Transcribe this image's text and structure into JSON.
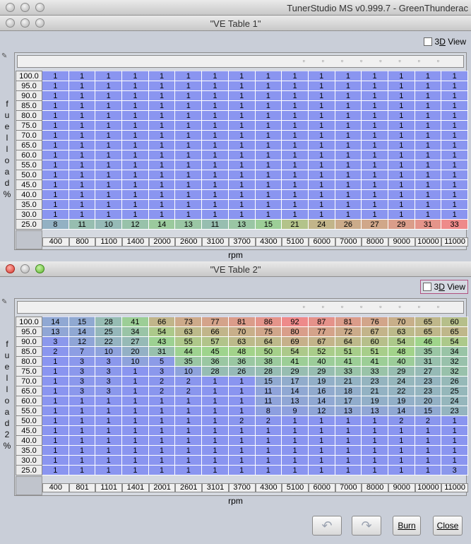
{
  "app_title": "TunerStudio MS v0.999.7 - GreenThunderac",
  "table1": {
    "title": "\"VE Table 1\"",
    "view3d_label_pre": "3",
    "view3d_label_u": "D",
    "view3d_label_post": " View",
    "y_axis_title": [
      "f",
      "u",
      "e",
      "l",
      "l",
      "o",
      "a",
      "d",
      "%"
    ],
    "x_axis_title": "rpm",
    "y_labels": [
      "100.0",
      "95.0",
      "90.0",
      "85.0",
      "80.0",
      "75.0",
      "70.0",
      "65.0",
      "60.0",
      "55.0",
      "50.0",
      "45.0",
      "40.0",
      "35.0",
      "30.0",
      "25.0"
    ],
    "x_labels": [
      "400",
      "800",
      "1100",
      "1400",
      "2000",
      "2600",
      "3100",
      "3700",
      "4300",
      "5100",
      "6000",
      "7000",
      "8000",
      "9000",
      "10000",
      "11000"
    ],
    "rows": [
      [
        1,
        1,
        1,
        1,
        1,
        1,
        1,
        1,
        1,
        1,
        1,
        1,
        1,
        1,
        1,
        1
      ],
      [
        1,
        1,
        1,
        1,
        1,
        1,
        1,
        1,
        1,
        1,
        1,
        1,
        1,
        1,
        1,
        1
      ],
      [
        1,
        1,
        1,
        1,
        1,
        1,
        1,
        1,
        1,
        1,
        1,
        1,
        1,
        1,
        1,
        1
      ],
      [
        1,
        1,
        1,
        1,
        1,
        1,
        1,
        1,
        1,
        1,
        1,
        1,
        1,
        1,
        1,
        1
      ],
      [
        1,
        1,
        1,
        1,
        1,
        1,
        1,
        1,
        1,
        1,
        1,
        1,
        1,
        1,
        1,
        1
      ],
      [
        1,
        1,
        1,
        1,
        1,
        1,
        1,
        1,
        1,
        1,
        1,
        1,
        1,
        1,
        1,
        1
      ],
      [
        1,
        1,
        1,
        1,
        1,
        1,
        1,
        1,
        1,
        1,
        1,
        1,
        1,
        1,
        1,
        1
      ],
      [
        1,
        1,
        1,
        1,
        1,
        1,
        1,
        1,
        1,
        1,
        1,
        1,
        1,
        1,
        1,
        1
      ],
      [
        1,
        1,
        1,
        1,
        1,
        1,
        1,
        1,
        1,
        1,
        1,
        1,
        1,
        1,
        1,
        1
      ],
      [
        1,
        1,
        1,
        1,
        1,
        1,
        1,
        1,
        1,
        1,
        1,
        1,
        1,
        1,
        1,
        1
      ],
      [
        1,
        1,
        1,
        1,
        1,
        1,
        1,
        1,
        1,
        1,
        1,
        1,
        1,
        1,
        1,
        1
      ],
      [
        1,
        1,
        1,
        1,
        1,
        1,
        1,
        1,
        1,
        1,
        1,
        1,
        1,
        1,
        1,
        1
      ],
      [
        1,
        1,
        1,
        1,
        1,
        1,
        1,
        1,
        1,
        1,
        1,
        1,
        1,
        1,
        1,
        1
      ],
      [
        1,
        1,
        1,
        1,
        1,
        1,
        1,
        1,
        1,
        1,
        1,
        1,
        1,
        1,
        1,
        1
      ],
      [
        1,
        1,
        1,
        1,
        1,
        1,
        1,
        1,
        1,
        1,
        1,
        1,
        1,
        1,
        1,
        1
      ],
      [
        8,
        11,
        10,
        12,
        14,
        13,
        11,
        13,
        15,
        21,
        24,
        26,
        27,
        29,
        31,
        33
      ]
    ]
  },
  "table2": {
    "title": "\"VE Table 2\"",
    "view3d_label_pre": "3",
    "view3d_label_u": "D",
    "view3d_label_post": " View",
    "y_axis_title": [
      "f",
      "u",
      "e",
      "l",
      "l",
      "o",
      "a",
      "d",
      "2",
      "%"
    ],
    "x_axis_title": "rpm",
    "y_labels": [
      "100.0",
      "95.0",
      "90.0",
      "85.0",
      "80.0",
      "75.0",
      "70.0",
      "65.0",
      "60.0",
      "55.0",
      "50.0",
      "45.0",
      "40.0",
      "35.0",
      "30.0",
      "25.0"
    ],
    "x_labels": [
      "400",
      "801",
      "1101",
      "1401",
      "2001",
      "2601",
      "3101",
      "3700",
      "4300",
      "5100",
      "6000",
      "7000",
      "8000",
      "9000",
      "10000",
      "11000"
    ],
    "rows": [
      [
        14,
        15,
        28,
        41,
        66,
        73,
        77,
        81,
        86,
        92,
        87,
        81,
        76,
        70,
        65,
        60
      ],
      [
        13,
        14,
        25,
        34,
        54,
        63,
        66,
        70,
        75,
        80,
        77,
        72,
        67,
        63,
        65,
        65
      ],
      [
        3,
        12,
        22,
        27,
        43,
        55,
        57,
        63,
        64,
        69,
        67,
        64,
        60,
        54,
        46,
        54
      ],
      [
        2,
        7,
        10,
        20,
        31,
        44,
        45,
        48,
        50,
        54,
        52,
        51,
        51,
        48,
        35,
        34
      ],
      [
        1,
        3,
        3,
        10,
        5,
        35,
        36,
        36,
        38,
        41,
        40,
        41,
        41,
        40,
        31,
        32
      ],
      [
        1,
        3,
        3,
        1,
        3,
        10,
        28,
        26,
        28,
        29,
        29,
        33,
        33,
        29,
        27,
        32
      ],
      [
        1,
        3,
        3,
        1,
        2,
        2,
        1,
        1,
        15,
        17,
        19,
        21,
        23,
        24,
        23,
        26
      ],
      [
        1,
        3,
        3,
        1,
        2,
        2,
        1,
        1,
        11,
        14,
        16,
        18,
        21,
        22,
        23,
        25
      ],
      [
        1,
        1,
        1,
        1,
        1,
        1,
        1,
        1,
        11,
        13,
        14,
        17,
        19,
        19,
        20,
        24
      ],
      [
        1,
        1,
        1,
        1,
        1,
        1,
        1,
        1,
        8,
        9,
        12,
        13,
        13,
        14,
        15,
        23
      ],
      [
        1,
        1,
        1,
        1,
        1,
        1,
        1,
        2,
        2,
        1,
        1,
        1,
        1,
        2,
        2,
        1
      ],
      [
        1,
        1,
        1,
        1,
        1,
        1,
        1,
        1,
        1,
        1,
        1,
        1,
        1,
        1,
        1,
        1
      ],
      [
        1,
        1,
        1,
        1,
        1,
        1,
        1,
        1,
        1,
        1,
        1,
        1,
        1,
        1,
        1,
        1
      ],
      [
        1,
        1,
        1,
        1,
        1,
        1,
        1,
        1,
        1,
        1,
        1,
        1,
        1,
        1,
        1,
        1
      ],
      [
        1,
        1,
        1,
        1,
        1,
        1,
        1,
        1,
        1,
        1,
        1,
        1,
        1,
        1,
        1,
        1
      ],
      [
        1,
        1,
        1,
        1,
        1,
        1,
        1,
        1,
        1,
        1,
        1,
        1,
        1,
        1,
        1,
        3
      ]
    ]
  },
  "buttons": {
    "undo_icon": "undo-icon",
    "redo_icon": "redo-icon",
    "burn_label": "Burn",
    "close_label": "Close"
  },
  "colors": {
    "cell_base": "#8a95f0",
    "scale_low": "#8a95f0",
    "scale_mid": "#9fd68a",
    "scale_high": "#ee8a8a"
  }
}
